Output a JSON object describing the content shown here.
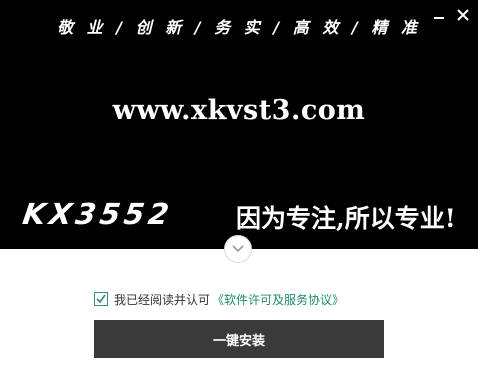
{
  "banner": {
    "slogan": "敬 业 / 创 新 / 务 实 / 高 效 / 精 准",
    "website": "www.xkvst3.com",
    "brand": "KX3552",
    "tagline": "因为专注,所以专业!"
  },
  "window_controls": {
    "minimize_icon": "minimize-icon",
    "close_icon": "close-icon"
  },
  "expand_icon": "chevron-down-icon",
  "agreement": {
    "checked": true,
    "text": "我已经阅读并认可",
    "link": "《软件许可及服务协议》"
  },
  "install_button": "一键安装",
  "colors": {
    "banner_bg": "#000000",
    "button_bg": "#3a3a3a",
    "link": "#1f8a70",
    "check": "#2f8f86"
  }
}
